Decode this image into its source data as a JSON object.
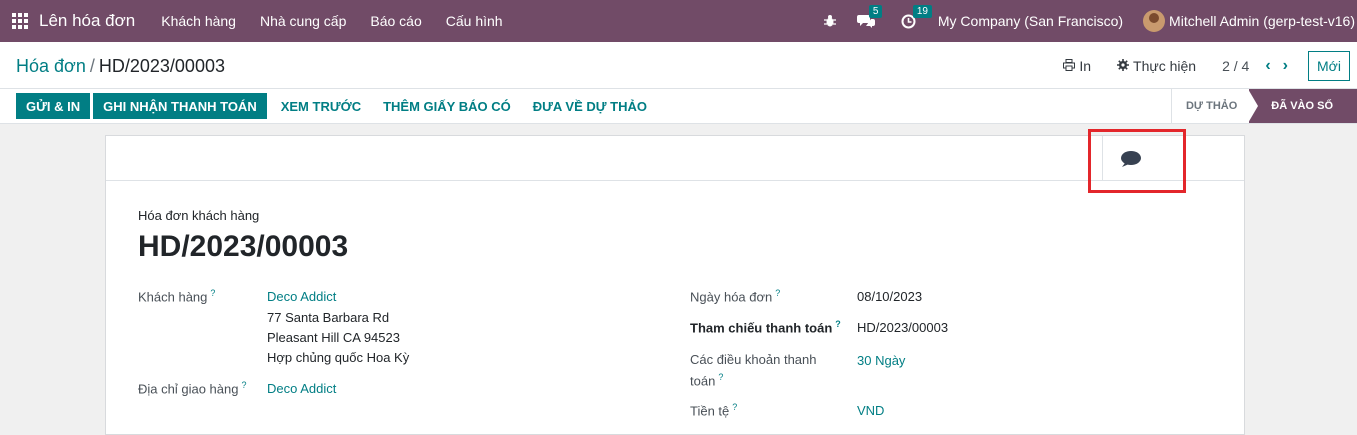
{
  "navbar": {
    "app_title": "Lên hóa đơn",
    "menu": [
      "Khách hàng",
      "Nhà cung cấp",
      "Báo cáo",
      "Cấu hình"
    ],
    "messages_count": "5",
    "activities_count": "19",
    "company": "My Company (San Francisco)",
    "user": "Mitchell Admin (gerp-test-v16)"
  },
  "breadcrumb": {
    "parent": "Hóa đơn",
    "separator": "/",
    "current": "HD/2023/00003"
  },
  "control": {
    "print_label": "In",
    "action_label": "Thực hiện",
    "pager": "2 / 4",
    "new_label": "Mới"
  },
  "statusbar": {
    "buttons": [
      "GỬI & IN",
      "GHI NHẬN THANH TOÁN",
      "XEM TRƯỚC",
      "THÊM GIẤY BÁO CÓ",
      "ĐƯA VỀ DỰ THẢO"
    ],
    "state_draft": "DỰ THẢO",
    "state_posted": "ĐÃ VÀO SỔ"
  },
  "invoice": {
    "type": "Hóa đơn khách hàng",
    "name": "HD/2023/00003",
    "customer_label": "Khách hàng",
    "customer": "Deco Addict",
    "address_line1": "77 Santa Barbara Rd",
    "address_line2": "Pleasant Hill CA 94523",
    "address_line3": "Hợp chủng quốc Hoa Kỳ",
    "delivery_label": "Địa chỉ giao hàng",
    "delivery": "Deco Addict",
    "date_label": "Ngày hóa đơn",
    "date": "08/10/2023",
    "ref_label": "Tham chiếu thanh toán",
    "ref": "HD/2023/00003",
    "terms_label_1": "Các điều khoản thanh",
    "terms_label_2": "toán",
    "terms": "30 Ngày",
    "currency_label": "Tiền tệ",
    "currency": "VND",
    "help_mark": "?"
  },
  "colors": {
    "brand": "#714B67",
    "accent": "#017e84",
    "highlight": "#e3262b"
  }
}
